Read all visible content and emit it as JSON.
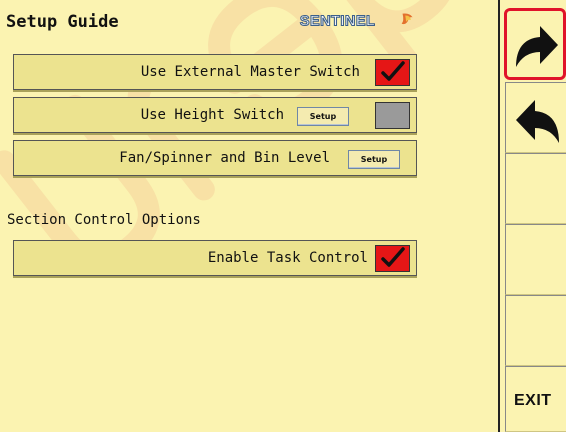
{
  "header": {
    "title": "Setup Guide",
    "brand": "SENTINEL"
  },
  "options": [
    {
      "label": "Use External Master Switch",
      "checked": true,
      "has_setup": false
    },
    {
      "label": "Use Height Switch",
      "checked": false,
      "has_setup": true,
      "setup_label": "Setup"
    },
    {
      "label": "Fan/Spinner and Bin Level",
      "has_setup": true,
      "setup_label": "Setup"
    }
  ],
  "section_control": {
    "heading": "Section Control Options",
    "task_control": {
      "label": "Enable Task Control",
      "checked": true
    }
  },
  "sidebar": {
    "buttons": [
      {
        "name": "next",
        "icon": "arrow-right-icon",
        "highlighted": true
      },
      {
        "name": "back",
        "icon": "arrow-left-icon",
        "highlighted": false
      },
      {
        "name": "blank-1"
      },
      {
        "name": "blank-2"
      },
      {
        "name": "blank-3"
      },
      {
        "name": "exit",
        "label": "EXIT"
      }
    ]
  },
  "colors": {
    "background": "#fbf3b1",
    "row": "#ece38f",
    "checkbox_checked": "#e51616",
    "checkbox_unchecked": "#9a9a9a",
    "highlight": "#e0132a",
    "watermark": "#f0b37a"
  }
}
